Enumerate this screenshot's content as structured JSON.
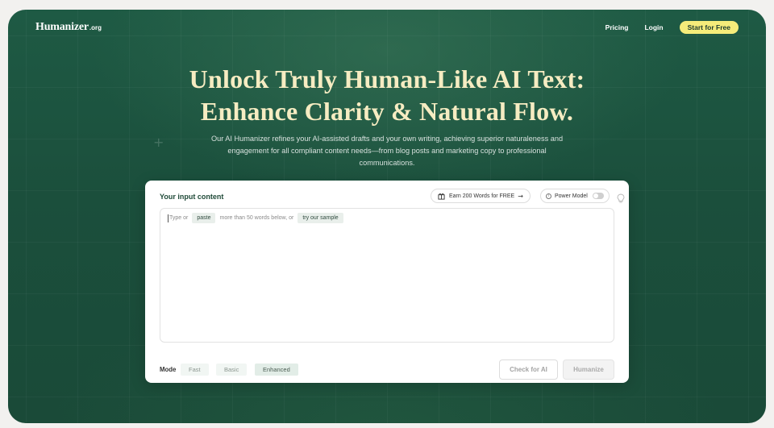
{
  "header": {
    "logo_main": "Humanizer",
    "logo_suffix": ".org",
    "nav": {
      "pricing": "Pricing",
      "login": "Login",
      "cta": "Start for Free"
    }
  },
  "hero": {
    "title_line1": "Unlock Truly Human-Like AI Text:",
    "title_line2": "Enhance Clarity & Natural Flow.",
    "subtitle": "Our AI Humanizer refines your AI-assisted drafts and your own writing, achieving superior naturaleness and engagement for all compliant content needs—from blog posts and marketing copy to professional communications."
  },
  "card": {
    "title": "Your input content",
    "earn_label": "Earn 200 Words for FREE",
    "power_model_label": "Power Model",
    "power_model_on": false,
    "placeholder": {
      "prefix": "Type or",
      "paste_chip": "paste",
      "middle": "more than 50 words below, or",
      "sample_chip": "try our sample"
    },
    "mode": {
      "label": "Mode",
      "options": [
        "Fast",
        "Basic",
        "Enhanced"
      ],
      "selected": "Enhanced"
    },
    "actions": {
      "check": "Check for AI",
      "humanize": "Humanize"
    }
  },
  "colors": {
    "background_green": "#1b4f3c",
    "title_cream": "#f6ecc2",
    "cta_yellow": "#f5ec7a"
  }
}
